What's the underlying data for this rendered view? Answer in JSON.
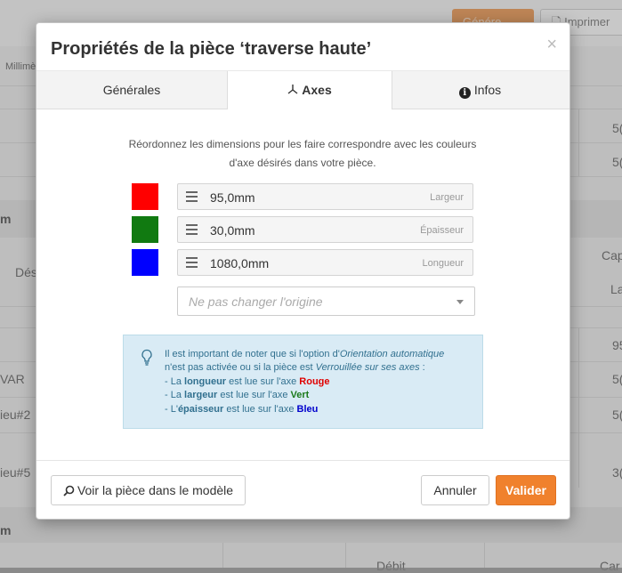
{
  "background": {
    "generate_label": "Génére",
    "print_label": "Imprimer",
    "units_label": "Millimè",
    "section_a_label": "m",
    "section_b_label": "m",
    "col_des_label": "Dés",
    "col_cap_label": "Cap",
    "col_la_label": "La",
    "col_debit_label": "Débit",
    "col_car_label": "Car",
    "row_var_label": "VAR",
    "row_ieu2_label": "ieu#2",
    "row_ieu5_label": "ieu#5",
    "right_values": [
      "5(",
      "5(",
      "95",
      "5(",
      "5(",
      "3("
    ]
  },
  "modal": {
    "title": "Propriétés de la pièce ‘traverse haute’",
    "close_symbol": "×",
    "tabs": [
      {
        "label": "Générales"
      },
      {
        "label": "Axes",
        "active": true
      },
      {
        "label": "Infos"
      }
    ],
    "description": "Réordonnez les dimensions pour les faire correspondre avec les couleurs d'axe désirés dans votre pièce.",
    "axes": [
      {
        "color": "#ff0000",
        "value": "95,0mm",
        "label": "Largeur"
      },
      {
        "color": "#117a11",
        "value": "30,0mm",
        "label": "Épaisseur"
      },
      {
        "color": "#0000ff",
        "value": "1080,0mm",
        "label": "Longueur"
      }
    ],
    "origin_select": {
      "placeholder": "Ne pas changer l'origine"
    },
    "note": {
      "line1_prefix": "Il est important de noter que si l'option d'",
      "line1_em": "Orientation automatique",
      "line2_prefix": "n'est pas activée ou si la pièce est ",
      "line2_em": "Verrouillée sur ses axes",
      "line2_suffix": " :",
      "item1_a": "- La ",
      "item1_b": "longueur",
      "item1_c": " est lue sur l'axe ",
      "item1_axis": "Rouge",
      "item2_a": "- La ",
      "item2_b": "largeur",
      "item2_c": " est lue sur l'axe ",
      "item2_axis": "Vert",
      "item3_a": "- L'",
      "item3_b": "épaisseur",
      "item3_c": " est lue sur l'axe ",
      "item3_axis": "Bleu"
    },
    "footer": {
      "view_label": "Voir la pièce dans le modèle",
      "cancel_label": "Annuler",
      "validate_label": "Valider"
    }
  },
  "colors": {
    "accent": "#f0812d",
    "info_bg": "#d9ebf5",
    "info_text": "#31708f"
  }
}
